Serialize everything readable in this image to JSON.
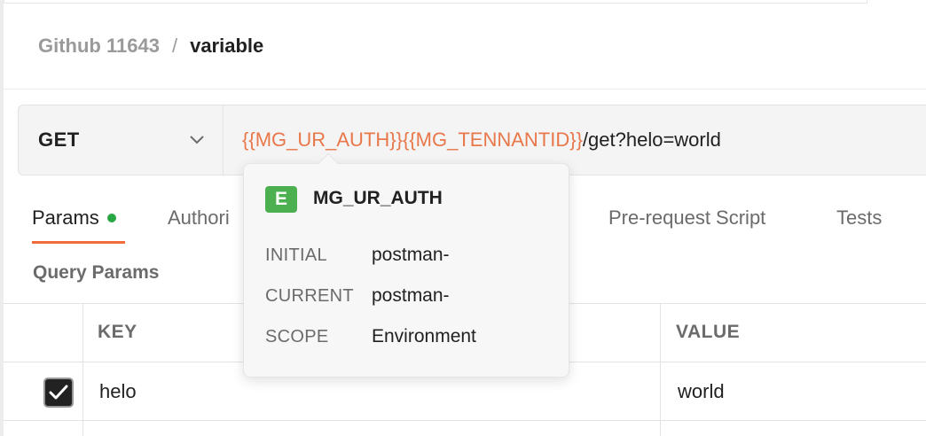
{
  "breadcrumb": {
    "parent": "Github 11643",
    "separator": "/",
    "current": "variable"
  },
  "request": {
    "method": "GET",
    "url_parts": {
      "var1": "{{MG_UR_AUTH}}",
      "var2": "{{MG_TENNANTID}}",
      "rest": "/get?helo=world"
    }
  },
  "tabs": [
    {
      "label": "Params",
      "active": true,
      "has_indicator": true
    },
    {
      "label": "Authori"
    },
    {
      "label": "Pre-request Script"
    },
    {
      "label": "Tests"
    }
  ],
  "query_params": {
    "title": "Query Params",
    "columns": {
      "key": "KEY",
      "value": "VALUE"
    },
    "rows": [
      {
        "checked": true,
        "key": "helo",
        "value": "world"
      }
    ]
  },
  "popover": {
    "badge": "E",
    "variable": "MG_UR_AUTH",
    "fields": [
      {
        "label": "INITIAL",
        "value": "postman-"
      },
      {
        "label": "CURRENT",
        "value": "postman-"
      },
      {
        "label": "SCOPE",
        "value": "Environment"
      }
    ]
  },
  "colors": {
    "accent": "#f26b3a",
    "variable_text": "#e8774a",
    "env_badge": "#4caf50",
    "indicator": "#28a745"
  },
  "icons": {
    "method_dropdown": "chevron-down-icon",
    "checkbox": "checkmark-icon"
  }
}
